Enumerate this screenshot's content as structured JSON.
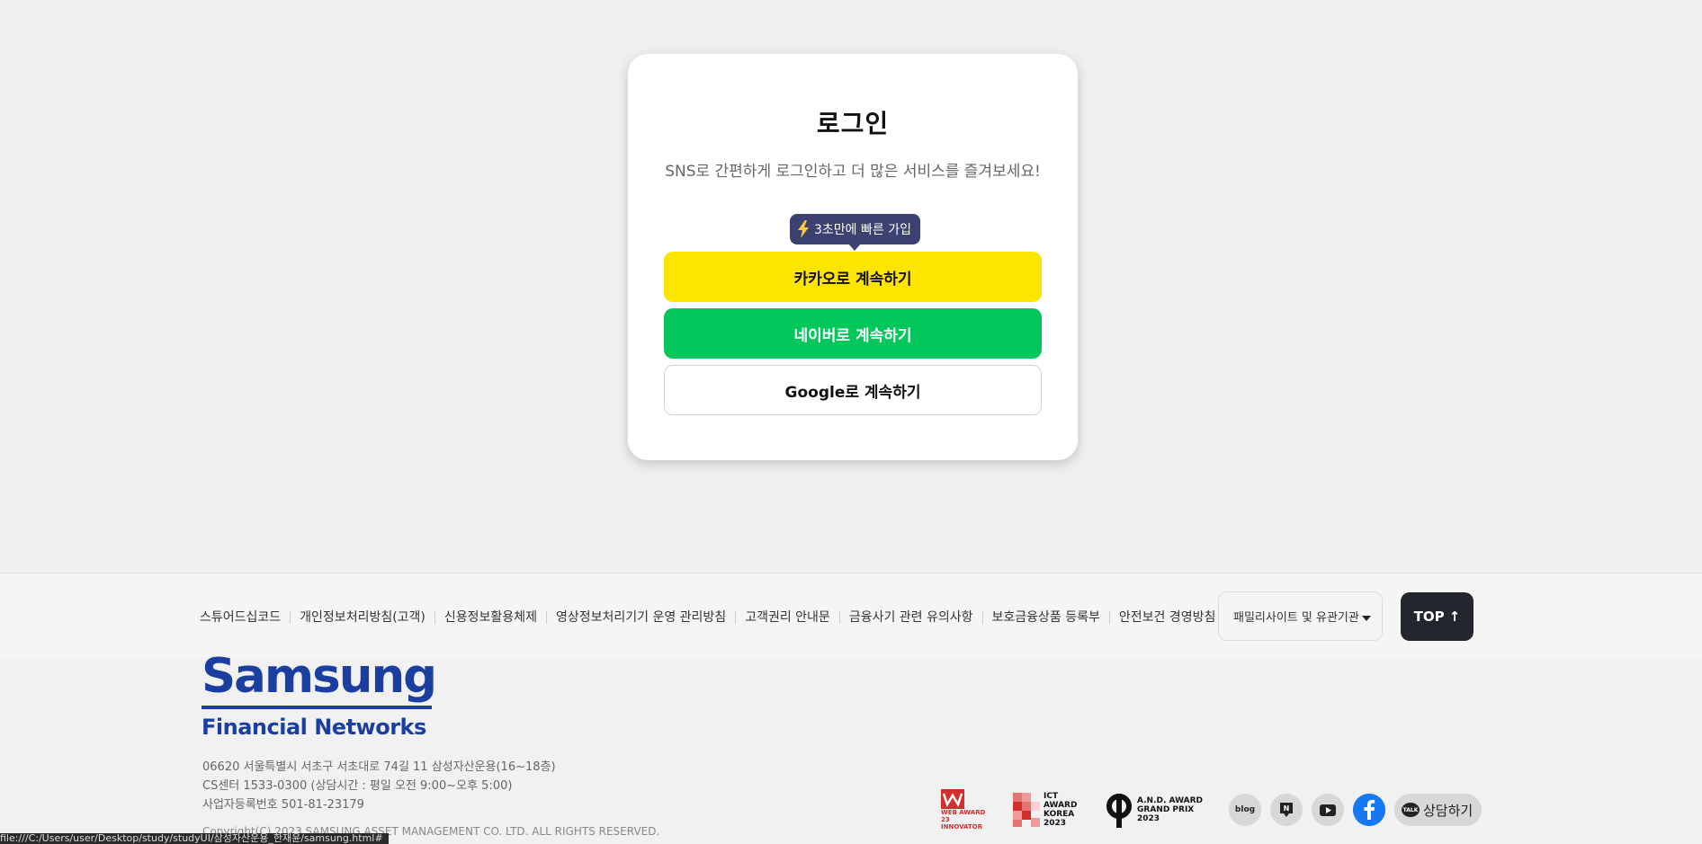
{
  "login": {
    "title": "로그인",
    "subtitle": "SNS로 간편하게 로그인하고 더 많은 서비스를 즐겨보세요!",
    "tooltip": "3초만에 빠른 가입",
    "kakao_label": "카카오로 계속하기",
    "naver_label": "네이버로 계속하기",
    "google_label": "Google로 계속하기"
  },
  "colors": {
    "kakao": "#fee500",
    "naver": "#03c75a",
    "tooltip": "#3b4170",
    "brand": "#1a3fa0"
  },
  "footer": {
    "links": [
      "스튜어드십코드",
      "개인정보처리방침(고객)",
      "신용정보활용체제",
      "영상정보처리기기 운영 관리방침",
      "고객권리 안내문",
      "금융사기 관련 유의사항",
      "보호금융상품 등록부",
      "안전보건 경영방침"
    ],
    "family_select": "패밀리사이트 및 유관기관",
    "top_label": "TOP ↑",
    "logo_main": "Samsung",
    "logo_sub": "Financial Networks",
    "address": "06620 서울특별시 서초구 서초대로 74길 11 삼성자산운용(16~18층)",
    "cs_center": "CS센터 1533-0300 (상담시간 : 평일 오전 9:00~오후 5:00)",
    "business_no": "사업자등록번호 501-81-23179",
    "copyright": "Copyright(C) 2023 SAMSUNG ASSET MANAGEMENT CO. LTD. ALL RIGHTS RESERVED.",
    "awards": {
      "web_award": "WEB AWARD 23 INNOVATOR",
      "ict_award": "ICT AWARD KOREA 2023",
      "and_award": "A.N.D. AWARD GRAND PRIX 2023"
    },
    "social": {
      "blog": "blog",
      "talk_label": "상담하기",
      "talk_bubble": "TALK"
    }
  },
  "statusbar": "file:///C:/Users/user/Desktop/study/studyUI/삼성자산운용_한재윤/samsung.html#"
}
